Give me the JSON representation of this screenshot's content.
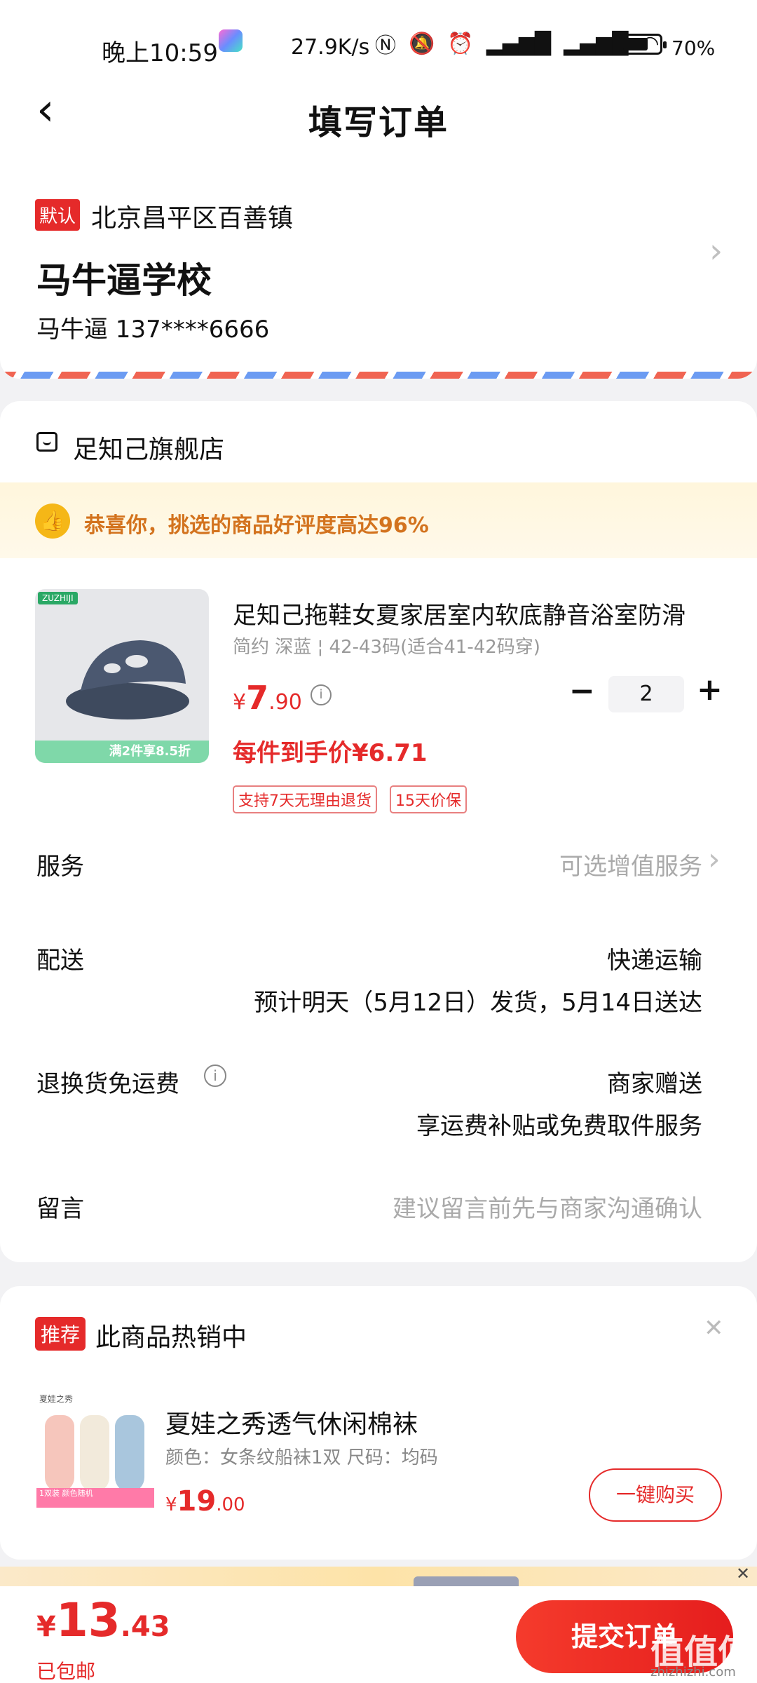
{
  "status_bar": {
    "time": "晚上10:59",
    "speed": "27.9K/s",
    "icons": [
      "nfc-icon",
      "mute-icon",
      "alarm-icon",
      "signal-hd-icon",
      "signal-hd-icon",
      "wifi-icon"
    ],
    "battery_level": 0.7,
    "battery_pct": "70%"
  },
  "header": {
    "title": "填写订单"
  },
  "address": {
    "default_tag": "默认",
    "region": "北京昌平区百善镇",
    "detail": "马牛逼学校",
    "contact": "马牛逼  137****6666"
  },
  "shop": {
    "name": "足知己旗舰店",
    "rating_banner": "恭喜你，挑选的商品好评度高达96%"
  },
  "product": {
    "brand_badge": "ZUZHIJI",
    "promo_badge": "满2件享8.5折",
    "title": "足知己拖鞋女夏家居室内软底静音浴室防滑",
    "spec": "简约 深蓝 ¦ 42-43码(适合41-42码穿)",
    "price_currency": "¥",
    "price_int": "7",
    "price_dec": ".90",
    "quantity": "2",
    "per_item_price": "每件到手价¥6.71",
    "service_tags": [
      "支持7天无理由退货",
      "15天价保"
    ]
  },
  "rows": {
    "service_label": "服务",
    "service_value": "可选增值服务",
    "delivery_label": "配送",
    "delivery_value": "快递运输",
    "delivery_sub": "预计明天（5月12日）发货，5月14日送达",
    "return_label": "退换货免运费",
    "return_value": "商家赠送",
    "return_sub": "享运费补贴或免费取件服务",
    "note_label": "留言",
    "note_placeholder": "建议留言前先与商家沟通确认"
  },
  "recommend": {
    "tag": "推荐",
    "title": "此商品热销中",
    "brand": "夏娃之秀",
    "image_banner": "1双装 颜色随机",
    "name": "夏娃之秀透气休闲棉袜",
    "spec": "颜色：女条纹船袜1双    尺码：均码",
    "price_currency": "¥",
    "price_int": "19",
    "price_dec": ".00",
    "buy_label": "一键购买"
  },
  "footer": {
    "total_currency": "¥",
    "total_int": "13",
    "total_dec": ".43",
    "shipping_note": "已包邮",
    "submit_label": "提交订单",
    "watermark": "值值值",
    "watermark_url": "zhizhizhi.com"
  },
  "colors": {
    "accent_red": "#e52a2a",
    "banner_orange": "#d3731e",
    "page_bg": "#f2f2f4"
  }
}
